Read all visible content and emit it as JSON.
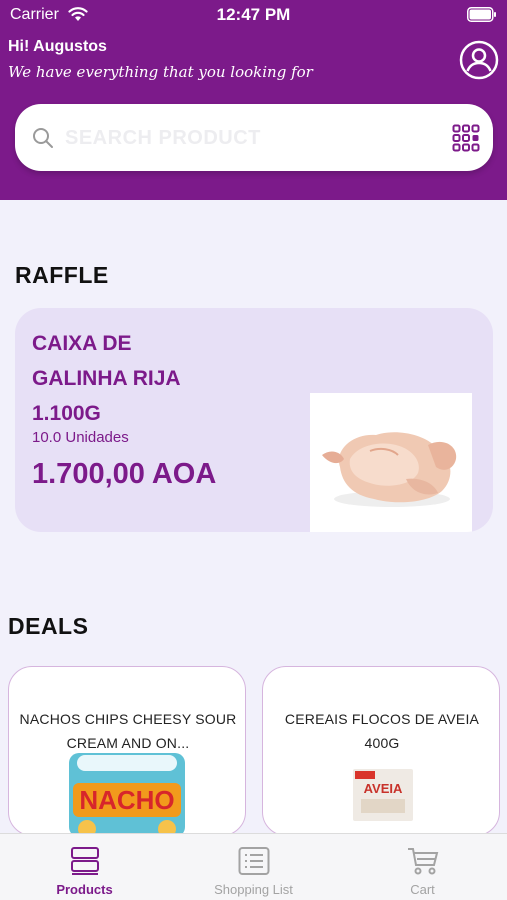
{
  "status_bar": {
    "carrier": "Carrier",
    "time": "12:47 PM"
  },
  "header": {
    "greeting": "Hi! Augustos",
    "tagline": "We have everything that you looking for"
  },
  "search": {
    "placeholder": "SEARCH PRODUCT"
  },
  "raffle": {
    "title": "RAFFLE",
    "product_name": "CAIXA DE GALINHA RIJA 1.100G",
    "units": "10.0  Unidades",
    "price": "1.700,00 AOA"
  },
  "deals": {
    "title": "DEALS",
    "items": [
      {
        "name": "NACHOS CHIPS CHEESY SOUR CREAM AND ON...",
        "image_text": "NACHO"
      },
      {
        "name": "CEREAIS FLOCOS DE AVEIA 400G",
        "image_text": "AVEIA"
      }
    ]
  },
  "tab_bar": {
    "items": [
      {
        "label": "Products",
        "icon": "products-icon",
        "active": true
      },
      {
        "label": "Shopping List",
        "icon": "shopping-list-icon",
        "active": false
      },
      {
        "label": "Cart",
        "icon": "cart-icon",
        "active": false
      }
    ]
  },
  "colors": {
    "brand_purple": "#7c1a8a",
    "page_background": "#f2f1fb",
    "raffle_card": "#e7e0f6",
    "tab_inactive": "#a3a3a3"
  }
}
